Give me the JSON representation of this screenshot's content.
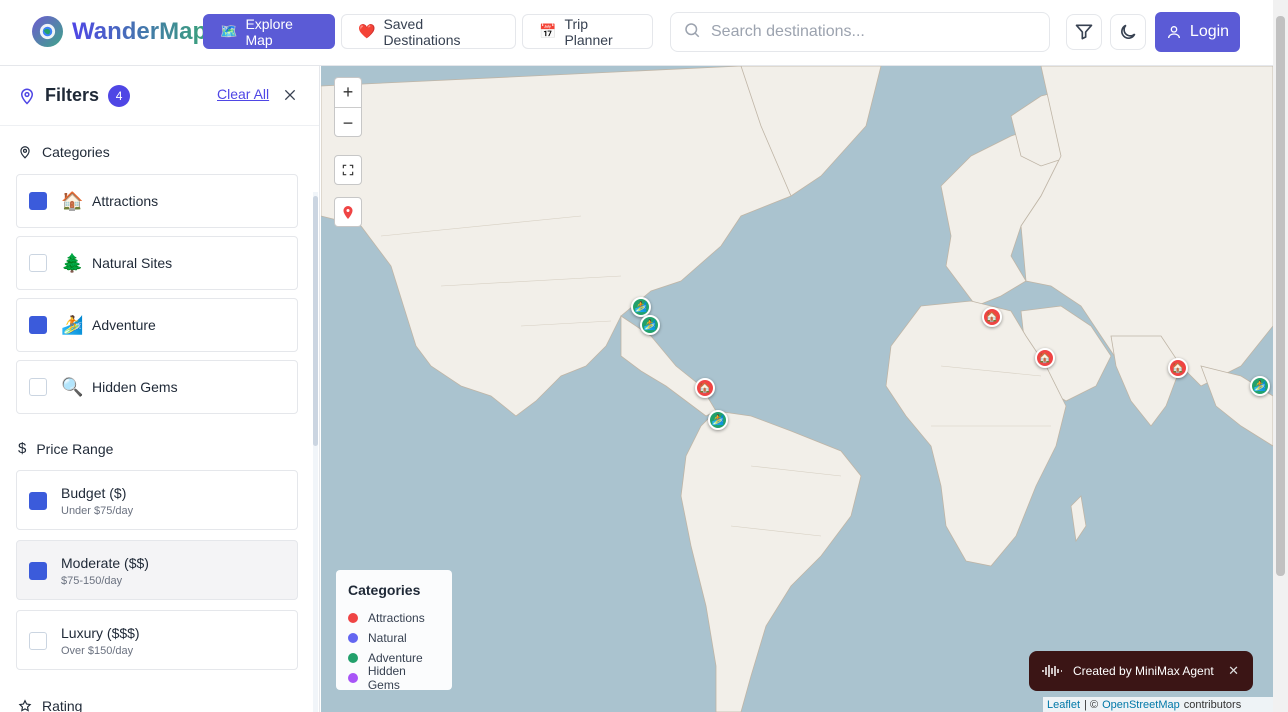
{
  "app": {
    "logo_text": "WanderMap",
    "logo_icon": "globe-icon"
  },
  "nav": {
    "explore": {
      "label": "Explore Map",
      "emoji": "🗺️"
    },
    "saved": {
      "label": "Saved Destinations",
      "emoji": "❤️"
    },
    "planner": {
      "label": "Trip Planner",
      "emoji": "📅"
    }
  },
  "search": {
    "placeholder": "Search destinations...",
    "value": ""
  },
  "header_actions": {
    "filter_icon": "filter-icon",
    "theme_icon": "moon-icon",
    "login_label": "Login",
    "login_icon": "user-icon"
  },
  "filters": {
    "title": "Filters",
    "count": "4",
    "clear_all": "Clear All",
    "categories_title": "Categories",
    "categories": [
      {
        "emoji": "🏠",
        "label": "Attractions",
        "checked": true
      },
      {
        "emoji": "🌲",
        "label": "Natural Sites",
        "checked": false
      },
      {
        "emoji": "🏄",
        "label": "Adventure",
        "checked": true
      },
      {
        "emoji": "🔍",
        "label": "Hidden Gems",
        "checked": false
      }
    ],
    "price_title": "Price Range",
    "prices": [
      {
        "label": "Budget ($)",
        "sub": "Under $75/day",
        "checked": true
      },
      {
        "label": "Moderate ($$)",
        "sub": "$75-150/day",
        "checked": true
      },
      {
        "label": "Luxury ($$$)",
        "sub": "Over $150/day",
        "checked": false
      }
    ],
    "rating_title": "Rating"
  },
  "map": {
    "zoom_in": "+",
    "zoom_out": "−",
    "legend": {
      "title": "Categories",
      "items": [
        {
          "label": "Attractions",
          "color": "#ef4444"
        },
        {
          "label": "Natural",
          "color": "#6366f1"
        },
        {
          "label": "Adventure",
          "color": "#22a06b"
        },
        {
          "label": "Hidden Gems",
          "color": "#a855f7"
        }
      ]
    },
    "attribution": {
      "leaflet": "Leaflet",
      "sep": "| ©",
      "osm": "OpenStreetMap",
      "suffix": "contributors"
    }
  },
  "toast": {
    "text": "Created by MiniMax Agent",
    "close": "✕"
  },
  "colors": {
    "accent": "#5b5bd6",
    "brand_blue": "#4f46e5",
    "brand_green": "#3aa37a"
  }
}
